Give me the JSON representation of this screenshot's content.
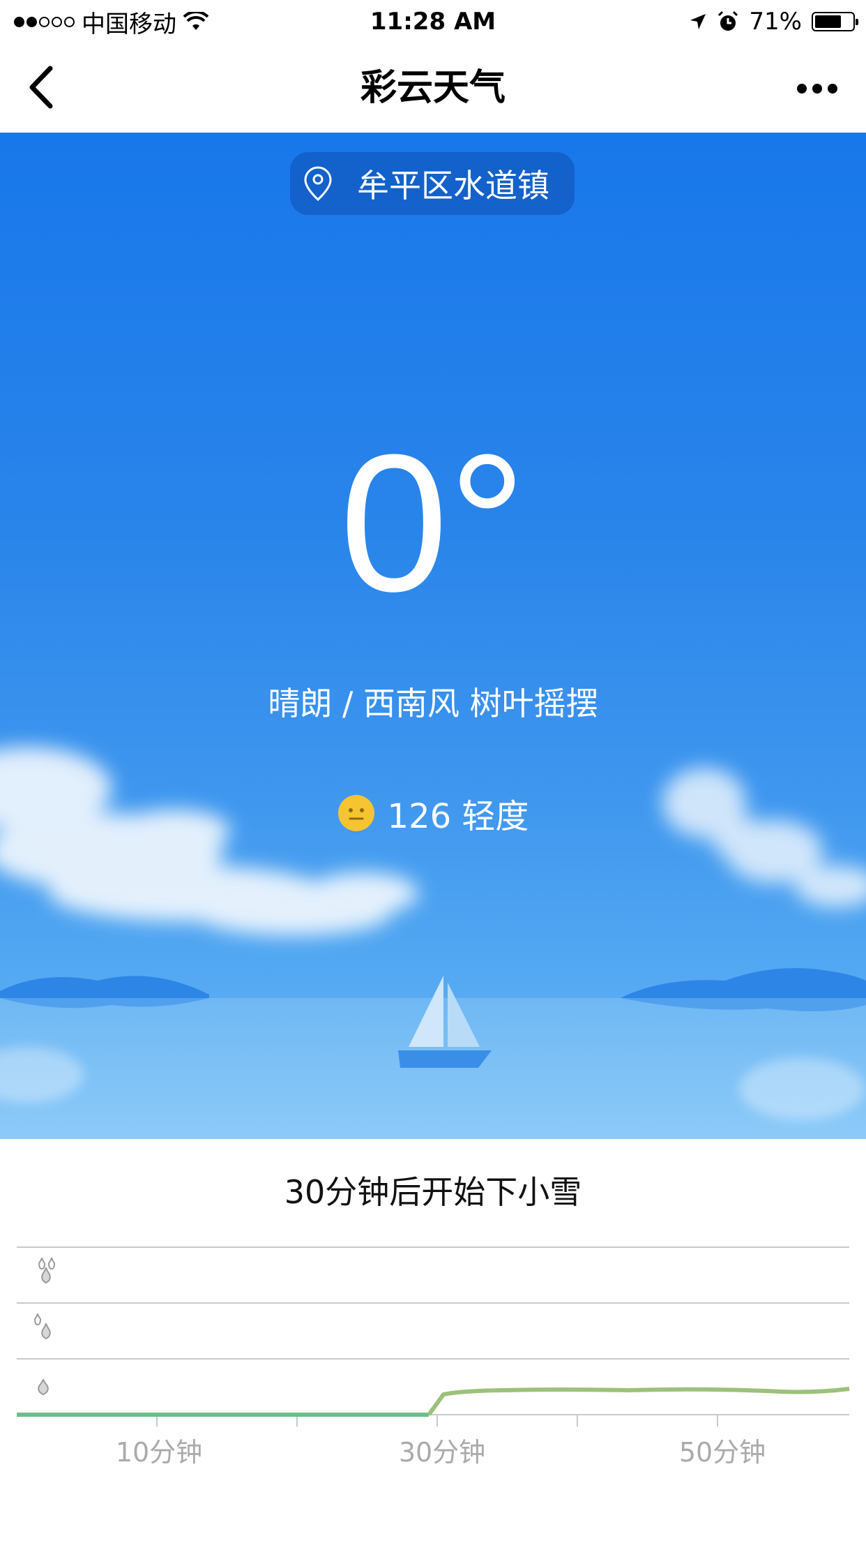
{
  "status_bar": {
    "carrier": "中国移动",
    "time": "11:28 AM",
    "battery": "71%",
    "battery_level": 0.71,
    "signal_bars": 2
  },
  "nav": {
    "title": "彩云天气",
    "back_icon": "chevron-left-icon",
    "more_icon": "more-dots-icon"
  },
  "weather": {
    "location": "牟平区水道镇",
    "temperature": "0°",
    "condition": "晴朗 / 西南风 树叶摇摆",
    "aqi": "126 轻度",
    "aqi_icon": "neutral-face-icon"
  },
  "forecast": {
    "title": "30分钟后开始下小雪",
    "x_labels": [
      "10分钟",
      "30分钟",
      "50分钟"
    ],
    "level_icons": [
      "heavy-drop-icon",
      "medium-drop-icon",
      "light-drop-icon"
    ]
  },
  "colors": {
    "sky_top": "#1877ea",
    "sky_bottom": "#7cc1f6",
    "precip_line_dry": "#6cbf8a",
    "precip_line_wet": "#9dc07a"
  }
}
